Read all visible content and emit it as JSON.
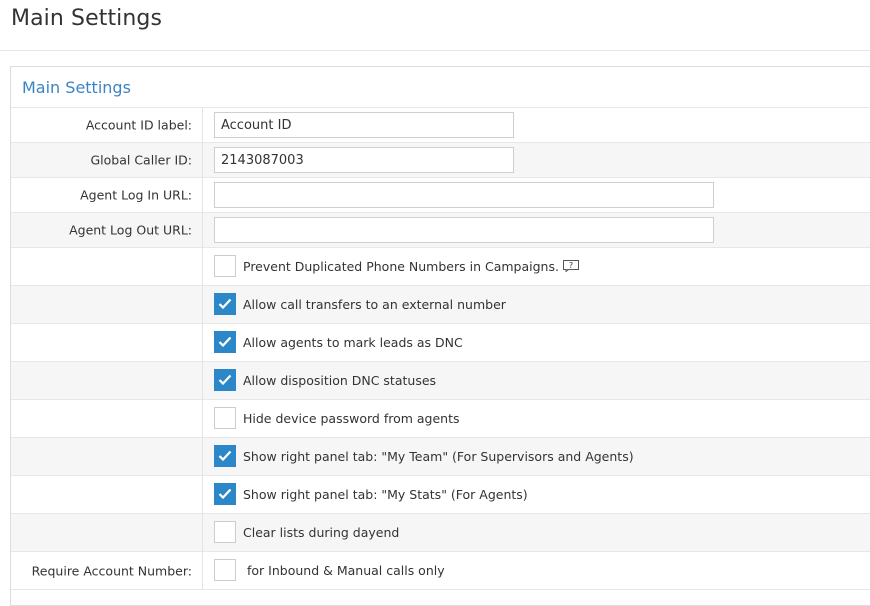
{
  "page": {
    "title": "Main Settings"
  },
  "panel": {
    "title": "Main Settings"
  },
  "fields": {
    "account_id_label": {
      "label": "Account ID label:",
      "value": "Account ID",
      "placeholder": ""
    },
    "global_caller_id": {
      "label": "Global Caller ID:",
      "value": "2143087003",
      "placeholder": ""
    },
    "agent_login_url": {
      "label": "Agent Log In URL:",
      "value": "",
      "placeholder": ""
    },
    "agent_logout_url": {
      "label": "Agent Log Out URL:",
      "value": "",
      "placeholder": ""
    }
  },
  "options": [
    {
      "label": "Prevent Duplicated Phone Numbers in Campaigns.",
      "checked": false,
      "help_icon": "question-bubble-icon"
    },
    {
      "label": "Allow call transfers to an external number",
      "checked": true
    },
    {
      "label": "Allow agents to mark leads as DNC",
      "checked": true
    },
    {
      "label": "Allow disposition DNC statuses",
      "checked": true
    },
    {
      "label": "Hide device password from agents",
      "checked": false
    },
    {
      "label": "Show right panel tab: \"My Team\" (For Supervisors and Agents)",
      "checked": true
    },
    {
      "label": "Show right panel tab: \"My Stats\" (For Agents)",
      "checked": true
    },
    {
      "label": "Clear lists during dayend",
      "checked": false
    }
  ],
  "require_account_number": {
    "label": "Require Account Number:",
    "option_label": "for Inbound & Manual calls only",
    "checked": false
  },
  "colors": {
    "accent": "#2b87c8",
    "panel_title": "#3a84c5"
  }
}
